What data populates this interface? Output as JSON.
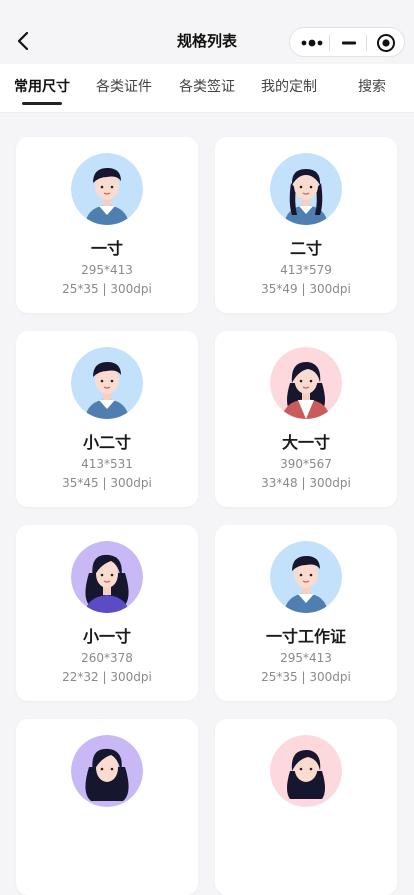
{
  "nav": {
    "title": "规格列表"
  },
  "tabs": [
    {
      "label": "常用尺寸",
      "active": true
    },
    {
      "label": "各类证件"
    },
    {
      "label": "各类签证"
    },
    {
      "label": "我的定制"
    },
    {
      "label": "搜索"
    }
  ],
  "cards": [
    {
      "name": "一寸",
      "pixels": "295*413",
      "spec": "25*35 | 300dpi",
      "avatar": "boy-blue-icon"
    },
    {
      "name": "二寸",
      "pixels": "413*579",
      "spec": "35*49 | 300dpi",
      "avatar": "girl-braids-blue-icon"
    },
    {
      "name": "小二寸",
      "pixels": "413*531",
      "spec": "35*45 | 300dpi",
      "avatar": "boy-blue-icon"
    },
    {
      "name": "大一寸",
      "pixels": "390*567",
      "spec": "33*48 | 300dpi",
      "avatar": "woman-pink-icon"
    },
    {
      "name": "小一寸",
      "pixels": "260*378",
      "spec": "22*32 | 300dpi",
      "avatar": "woman-purple-icon"
    },
    {
      "name": "一寸工作证",
      "pixels": "295*413",
      "spec": "25*35 | 300dpi",
      "avatar": "boy-blue-icon"
    },
    {
      "avatar": "woman-purple-icon"
    },
    {
      "avatar": "woman-pink-icon"
    }
  ],
  "colors": {
    "avatar_blue": "#c4e1fb",
    "avatar_pink": "#fdd8dc",
    "avatar_purple": "#c9b8f6",
    "text_muted": "#8a8a8a"
  }
}
